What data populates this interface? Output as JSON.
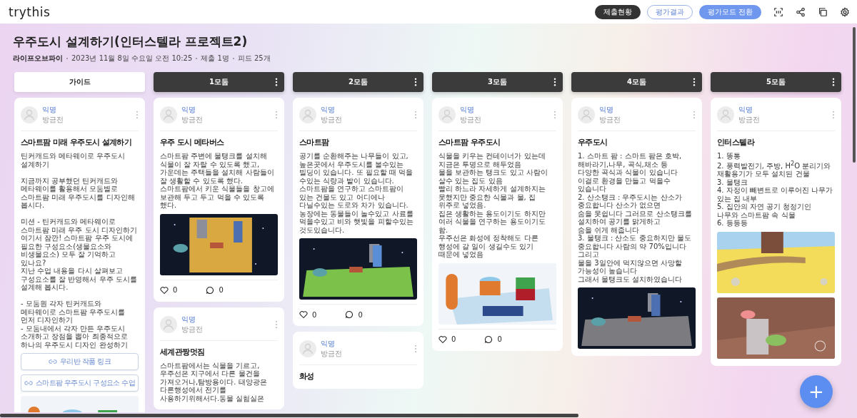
{
  "app": {
    "logo": "trythis",
    "buttons": [
      {
        "label": "제출현황",
        "kind": "dark"
      },
      {
        "label": "평가결과",
        "kind": "outline"
      },
      {
        "label": "평가모드 전환",
        "kind": "primary"
      }
    ]
  },
  "board": {
    "title": "우주도시 설계하기(인터스텔라 프로젝트2)",
    "meta": [
      "라이프오브파이",
      "2023년 11월 8일 수요일 오전 10:25",
      "제출 1명",
      "피드 25개"
    ]
  },
  "columns": [
    {
      "title": "가이드",
      "kind": "guide",
      "cards": [
        {
          "author": "익명",
          "time": "방금전",
          "title": "스마트팜 미래 우주도시 설계하기",
          "body": "틴커캐드와 메타웨이로 우주도시 설계하기\n\n지금까지 공부했던 틴커캐드와 메타웨이를 활용해서 모둠별로 스마트팜 미래 우주도시를 디자인해 봅시다.\n\n미션 - 틴커캐드와 메타웨이로 스마트팜 미래 우주 도시 디자인하기\n여기서 잠깐! 스마트팜 우주 도시에 필요한 구성요소(생물요소와 비생물요소) 모두 잘 기억하고 있나요?\n지난 수업 내용을 다시 살펴보고 구성요소를 잘 반영해서 우주 도시를 설계해 봅시다.\n\n- 모둠원 각자 틴커캐드와 메타웨이로 스마트팜 우주도시를 먼저 디자인하기\n- 모둠내에서 각자 만든 우주도시 소개하고 장점을 뽑아 최종적으로 하나의 우주도시 디자인 완성하기",
          "links": [
            "우리반 작품 링크",
            "스마트팜 우주도시 구성요소 수업"
          ],
          "pictures": [
            {
              "kind": "picture"
            }
          ]
        }
      ]
    },
    {
      "title": "1모둠",
      "kind": "group",
      "cards": [
        {
          "author": "익명",
          "time": "방금전",
          "title": "우주 도시 메타버스",
          "body": "스마트팜 주변에 물탱크를 설치해 식물이 잘 자랄 수 있도록 했고, 가운데는 주택들을 설치해 사람들이 잘 생활할 수 있도록 했다. 스마트팜에서 키운 식물들을 창고에 보관해 두고 두고 먹을 수 있도록 했다.",
          "pictures": [
            {
              "kind": "picture"
            }
          ],
          "likes": "0",
          "comments": "0"
        },
        {
          "author": "익명",
          "time": "방금전",
          "title": "세계관짱멋짐",
          "body": "스마트팜에서는 식물을 기르고,우주선은 지구에서 다른 물건을 가져오거나,탐방용이다. 태양광은 다른행성에서 전기를 사용하기위해서다.동물 실험실은"
        }
      ]
    },
    {
      "title": "2모둠",
      "kind": "group",
      "cards": [
        {
          "author": "익명",
          "time": "방금전",
          "title": "스마트팜",
          "body": "공기를 순환해주는 나무들이 있고, 높은곳에서 우주도시를 볼수있는 빌딩이 있습니다. 또 필요할 때 먹을 수있는 식량과 밭이 있습니다. 스마트팜을 연구하고 스마트팜이 있는 건물도 있고 어디에나 다닐수있는 도로와 차가 있습니다. 농장에는 동물들이 놀수있고 사료를 먹을수있고 비와 햇빛을 피할수있는 것도있습니다.",
          "pictures": [
            {
              "kind": "picture"
            }
          ],
          "likes": "0",
          "comments": "0"
        },
        {
          "author": "익명",
          "time": "방금전",
          "title": "화성"
        }
      ]
    },
    {
      "title": "3모둠",
      "kind": "group",
      "cards": [
        {
          "author": "익명",
          "time": "방금전",
          "title": "스마트팜 우주도시",
          "body": "식물을 키우는 컨테이너가 있는데 지금은 투명으로 해두었음\n물을 보관하는 탱크도 있고 사람이 살수 있는 집도 있음\n빨리 하느라 자세하게 설계하지는 못했지만 중요한 식물과 물, 집 위주로 넣었음.\n집은 생활하는 용도이기도 하지만 여러 식물을 연구하는 용도이기도 함.\n우주선은 화성에 정착해도 다른 행성에 갈 일이 생길수도 있기 때문에 넣었음",
          "pictures": [
            {
              "kind": "picture"
            }
          ],
          "likes": "0",
          "comments": "0"
        }
      ]
    },
    {
      "title": "4모둠",
      "kind": "group",
      "cards": [
        {
          "author": "익명",
          "time": "방금전",
          "title": "우주도시",
          "body": "1. 스마트 팜 : 스마트 팜은 호박, 해바라기,나무, 곡식,채소 등\n다양한 곡식과 식물이 있습니다 이걸로 환경을 만들고 먹을수 있습니다\n2. 산소탱크 : 우주도시는 산소가 중요합니다 산소가 없으면\n숨을 못쉽니다 그러므로 산소탱크를 설치하여 공기를 맑게하고\n숨을 쉬게 해줍니다\n3. 물탱크 : 산소도 중요하지만 물도\n중요합니다 사람의 약 70%입니다 그리고\n물을 3일안에 먹지않으면 사망할 가능성이 높습니다\n그래서 물탱크도 설치하였습니다",
          "pictures": [
            {
              "kind": "picture"
            }
          ]
        }
      ]
    },
    {
      "title": "5모둠",
      "kind": "group",
      "cards": [
        {
          "author": "익명",
          "time": "방금전",
          "title": "인터스텔라",
          "body": "1. 똥통\n2. 풍력발전기, 주방, H$^{2}$O 분리기와 재활용기가 모두 설치된 건물\n3. 물탱크\n4. 자정이 빼변트로 이루어진 나무가 있는 집 내부\n5. 집안의 자연 공기 청정기인 나무와 스마트팜 속 식물\n6. 등등등",
          "pictures": [
            {
              "kind": "picture"
            },
            {
              "kind": "picture"
            }
          ]
        }
      ]
    }
  ],
  "fab": {
    "label": "+"
  }
}
